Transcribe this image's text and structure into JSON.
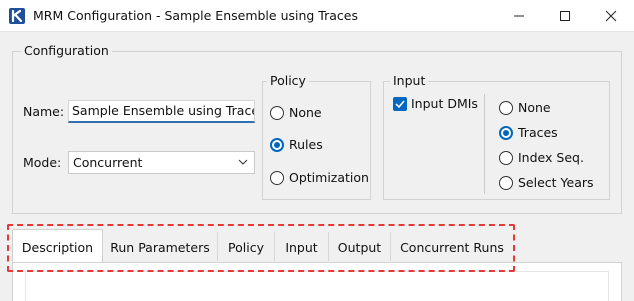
{
  "window": {
    "title": "MRM Configuration - Sample Ensemble using Traces",
    "accent_color": "#0067c0",
    "logo_color": "#1f4e9a"
  },
  "configuration": {
    "group_label": "Configuration",
    "name_label": "Name:",
    "name_value": "Sample Ensemble using Traces",
    "mode_label": "Mode:",
    "mode_value": "Concurrent"
  },
  "policy": {
    "group_label": "Policy",
    "options": [
      "None",
      "Rules",
      "Optimization"
    ],
    "selected": "Rules"
  },
  "input": {
    "group_label": "Input",
    "input_dmis_label": "Input DMIs",
    "input_dmis_checked": true,
    "options": [
      "None",
      "Traces",
      "Index Seq.",
      "Select Years"
    ],
    "selected": "Traces"
  },
  "tabs": {
    "items": [
      "Description",
      "Run Parameters",
      "Policy",
      "Input",
      "Output",
      "Concurrent Runs"
    ],
    "active": "Description",
    "highlight_color": "#e53935"
  }
}
